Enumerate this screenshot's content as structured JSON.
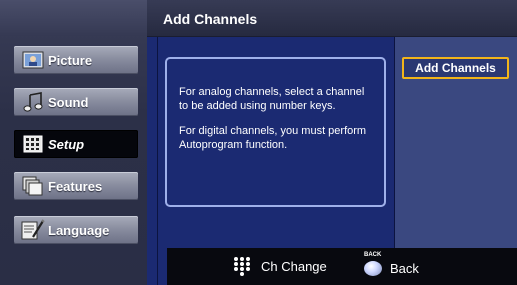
{
  "header": {
    "title": "Add Channels"
  },
  "menu": {
    "items": [
      {
        "label": "Picture",
        "icon": "picture-icon"
      },
      {
        "label": "Sound",
        "icon": "sound-icon"
      },
      {
        "label": "Setup",
        "icon": "setup-icon",
        "selected": true
      },
      {
        "label": "Features",
        "icon": "features-icon"
      },
      {
        "label": "Language",
        "icon": "language-icon"
      }
    ]
  },
  "info": {
    "line1": "For analog channels, select a channel to be added using number keys.",
    "line2": "For digital channels, you must perform Autoprogram function."
  },
  "options": {
    "add_channels": "Add Channels"
  },
  "help": {
    "ch_change": "Ch Change",
    "back_key": "BACK",
    "back": "Back"
  },
  "colors": {
    "highlight_border": "#f2b41a",
    "panel_blue": "#1b2a72",
    "info_border": "#9fb0ea"
  }
}
